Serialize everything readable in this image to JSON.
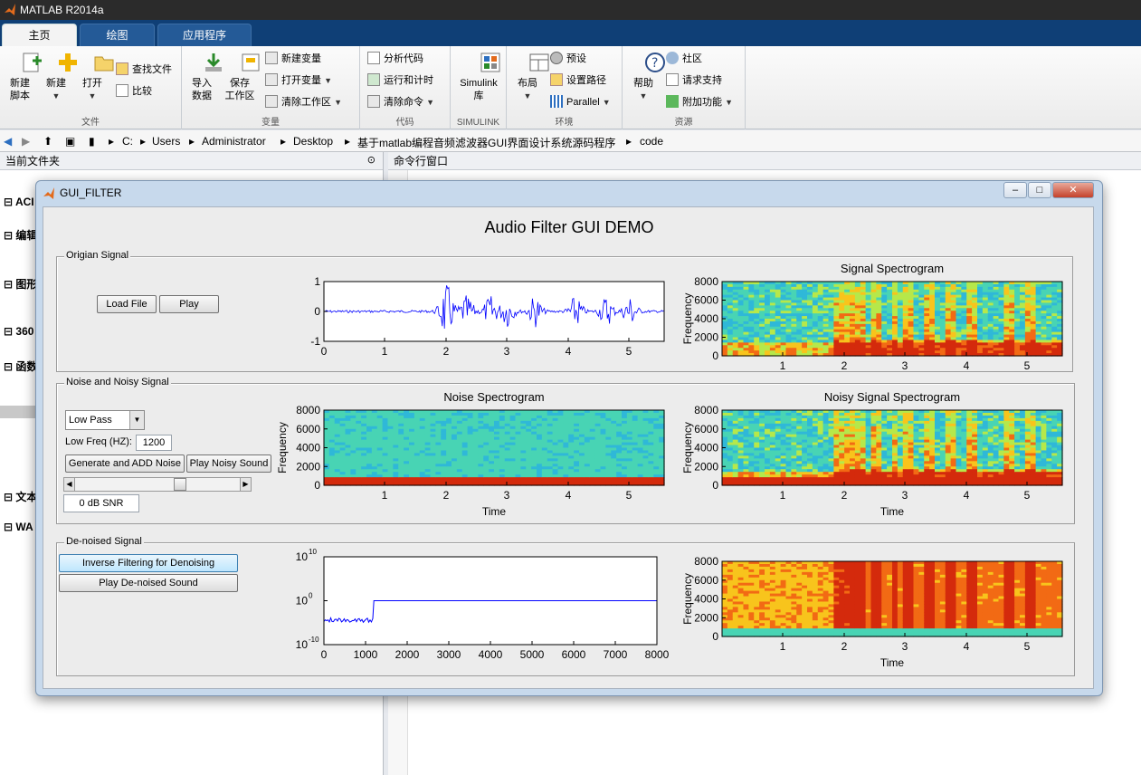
{
  "app": {
    "title": "MATLAB R2014a"
  },
  "tabs": [
    "主页",
    "绘图",
    "应用程序"
  ],
  "ribbon": {
    "file_group": {
      "label": "文件",
      "new_script": "新建\n脚本",
      "new": "新建",
      "open": "打开",
      "find_files": "查找文件",
      "compare": "比较"
    },
    "variable_group": {
      "label": "变量",
      "import_data": "导入\n数据",
      "save_workspace": "保存\n工作区",
      "new_variable": "新建变量",
      "open_variable": "打开变量",
      "clear_workspace": "清除工作区"
    },
    "code_group": {
      "label": "代码",
      "analyze_code": "分析代码",
      "run_and_time": "运行和计时",
      "clear_commands": "清除命令"
    },
    "simulink_group": {
      "label": "SIMULINK",
      "simulink_library": "Simulink\n库"
    },
    "environment_group": {
      "label": "环境",
      "layout": "布局",
      "preferences": "预设",
      "set_path": "设置路径",
      "parallel": "Parallel"
    },
    "resources_group": {
      "label": "资源",
      "help": "帮助",
      "community": "社区",
      "request_support": "请求支持",
      "add_ons": "附加功能"
    }
  },
  "address": {
    "path": [
      "C:",
      "Users",
      "Administrator",
      "Desktop",
      "基于matlab编程音频滤波器GUI界面设计系统源码程序",
      "code"
    ]
  },
  "left_panel": {
    "title": "当前文件夹",
    "items": [
      "ACI",
      "编辑",
      "图形",
      "360",
      "函数",
      "文本",
      "WA"
    ]
  },
  "command_window": {
    "title": "命令行窗口"
  },
  "gui": {
    "title": "GUI_FILTER",
    "heading": "Audio Filter GUI DEMO",
    "origin_panel": {
      "title": "Origian Signal",
      "load_file": "Load File",
      "play": "Play"
    },
    "noise_panel": {
      "title": "Noise and Noisy Signal",
      "filter_type": "Low Pass",
      "low_freq_label": "Low Freq (HZ):",
      "low_freq_value": "1200",
      "generate_button": "Generate and ADD Noise",
      "play_noisy_button": "Play Noisy Sound",
      "snr_value": "0 dB SNR",
      "snr_slider_fraction": 0.65
    },
    "denoise_panel": {
      "title": "De-noised Signal",
      "inverse_button": "Inverse Filtering for Denoising",
      "play_denoised_button": "Play De-noised Sound"
    },
    "plots": {
      "waveform": {
        "yticks": [
          "1",
          "0",
          "-1"
        ],
        "xticks": [
          "0",
          "1",
          "2",
          "3",
          "4",
          "5"
        ]
      },
      "signal_spectrogram": {
        "title": "Signal Spectrogram",
        "ylabel": "Frequency",
        "yticks": [
          "8000",
          "6000",
          "4000",
          "2000",
          "0"
        ],
        "xticks": [
          "1",
          "2",
          "3",
          "4",
          "5"
        ]
      },
      "noise_spectrogram": {
        "title": "Noise Spectrogram",
        "ylabel": "Frequency",
        "xlabel": "Time",
        "yticks": [
          "8000",
          "6000",
          "4000",
          "2000",
          "0"
        ],
        "xticks": [
          "1",
          "2",
          "3",
          "4",
          "5"
        ]
      },
      "noisy_spectrogram": {
        "title": "Noisy Signal Spectrogram",
        "ylabel": "Frequency",
        "xlabel": "Time",
        "yticks": [
          "8000",
          "6000",
          "4000",
          "2000",
          "0"
        ],
        "xticks": [
          "1",
          "2",
          "3",
          "4",
          "5"
        ]
      },
      "filter_response": {
        "yticks": [
          "10",
          "10",
          "10"
        ],
        "yexp": [
          "10",
          "0",
          "-10"
        ],
        "xticks": [
          "0",
          "1000",
          "2000",
          "3000",
          "4000",
          "5000",
          "6000",
          "7000",
          "8000"
        ]
      },
      "denoised_spectrogram": {
        "ylabel": "Frequency",
        "xlabel": "Time",
        "yticks": [
          "8000",
          "6000",
          "4000",
          "2000",
          "0"
        ],
        "xticks": [
          "1",
          "2",
          "3",
          "4",
          "5"
        ]
      }
    }
  },
  "colors": {
    "titlebar": "#2b2b2b",
    "tabbar": "#0f3f76",
    "plot_line": "#0000ff",
    "spec_bg": "#2fb8d8",
    "spec_hot": "#d42a0c"
  }
}
